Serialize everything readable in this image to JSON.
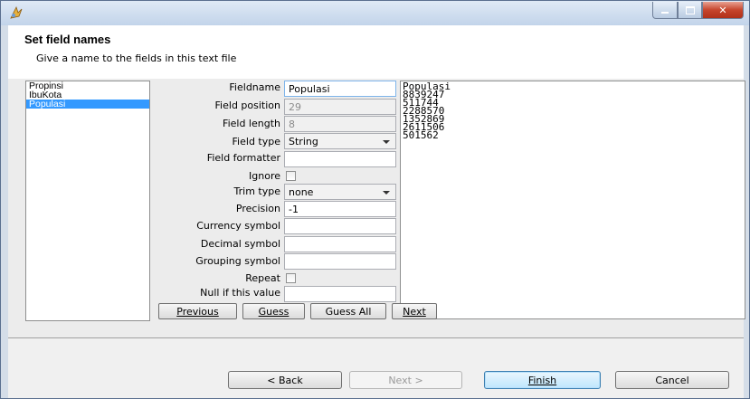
{
  "window": {
    "title": "",
    "buttons": {
      "minimize": "minimize-icon",
      "maximize": "maximize-icon",
      "close": "close-icon"
    }
  },
  "header": {
    "title": "Set field names",
    "description": "Give a name to the fields in this text file"
  },
  "fields": [
    "Propinsi",
    "IbuKota",
    "Populasi"
  ],
  "selected_field": "Populasi",
  "form": {
    "fieldname_label": "Fieldname",
    "fieldname_value": "Populasi",
    "field_position_label": "Field position",
    "field_position_value": "29",
    "field_length_label": "Field length",
    "field_length_value": "8",
    "field_type_label": "Field type",
    "field_type_value": "String",
    "field_formatter_label": "Field formatter",
    "field_formatter_value": "",
    "ignore_label": "Ignore",
    "trim_type_label": "Trim type",
    "trim_type_value": "none",
    "precision_label": "Precision",
    "precision_value": "-1",
    "currency_symbol_label": "Currency symbol",
    "currency_symbol_value": "",
    "decimal_symbol_label": "Decimal symbol",
    "decimal_symbol_value": "",
    "grouping_symbol_label": "Grouping symbol",
    "grouping_symbol_value": "",
    "repeat_label": "Repeat",
    "null_if_label": "Null if this value",
    "null_if_value": ""
  },
  "preview_lines": [
    "Populasi",
    "8839247",
    "511744",
    "2288570",
    "1352869",
    "2611506",
    "501562"
  ],
  "nav_buttons": {
    "previous": "Previous",
    "guess": "Guess",
    "guess_all": "Guess All",
    "next": "Next"
  },
  "footer_buttons": {
    "back": "< Back",
    "next": "Next >",
    "finish": "Finish",
    "cancel": "Cancel"
  },
  "colors": {
    "selection": "#3399ff",
    "title_gradient_top": "#dfe9f5",
    "close_button": "#c6452c"
  }
}
